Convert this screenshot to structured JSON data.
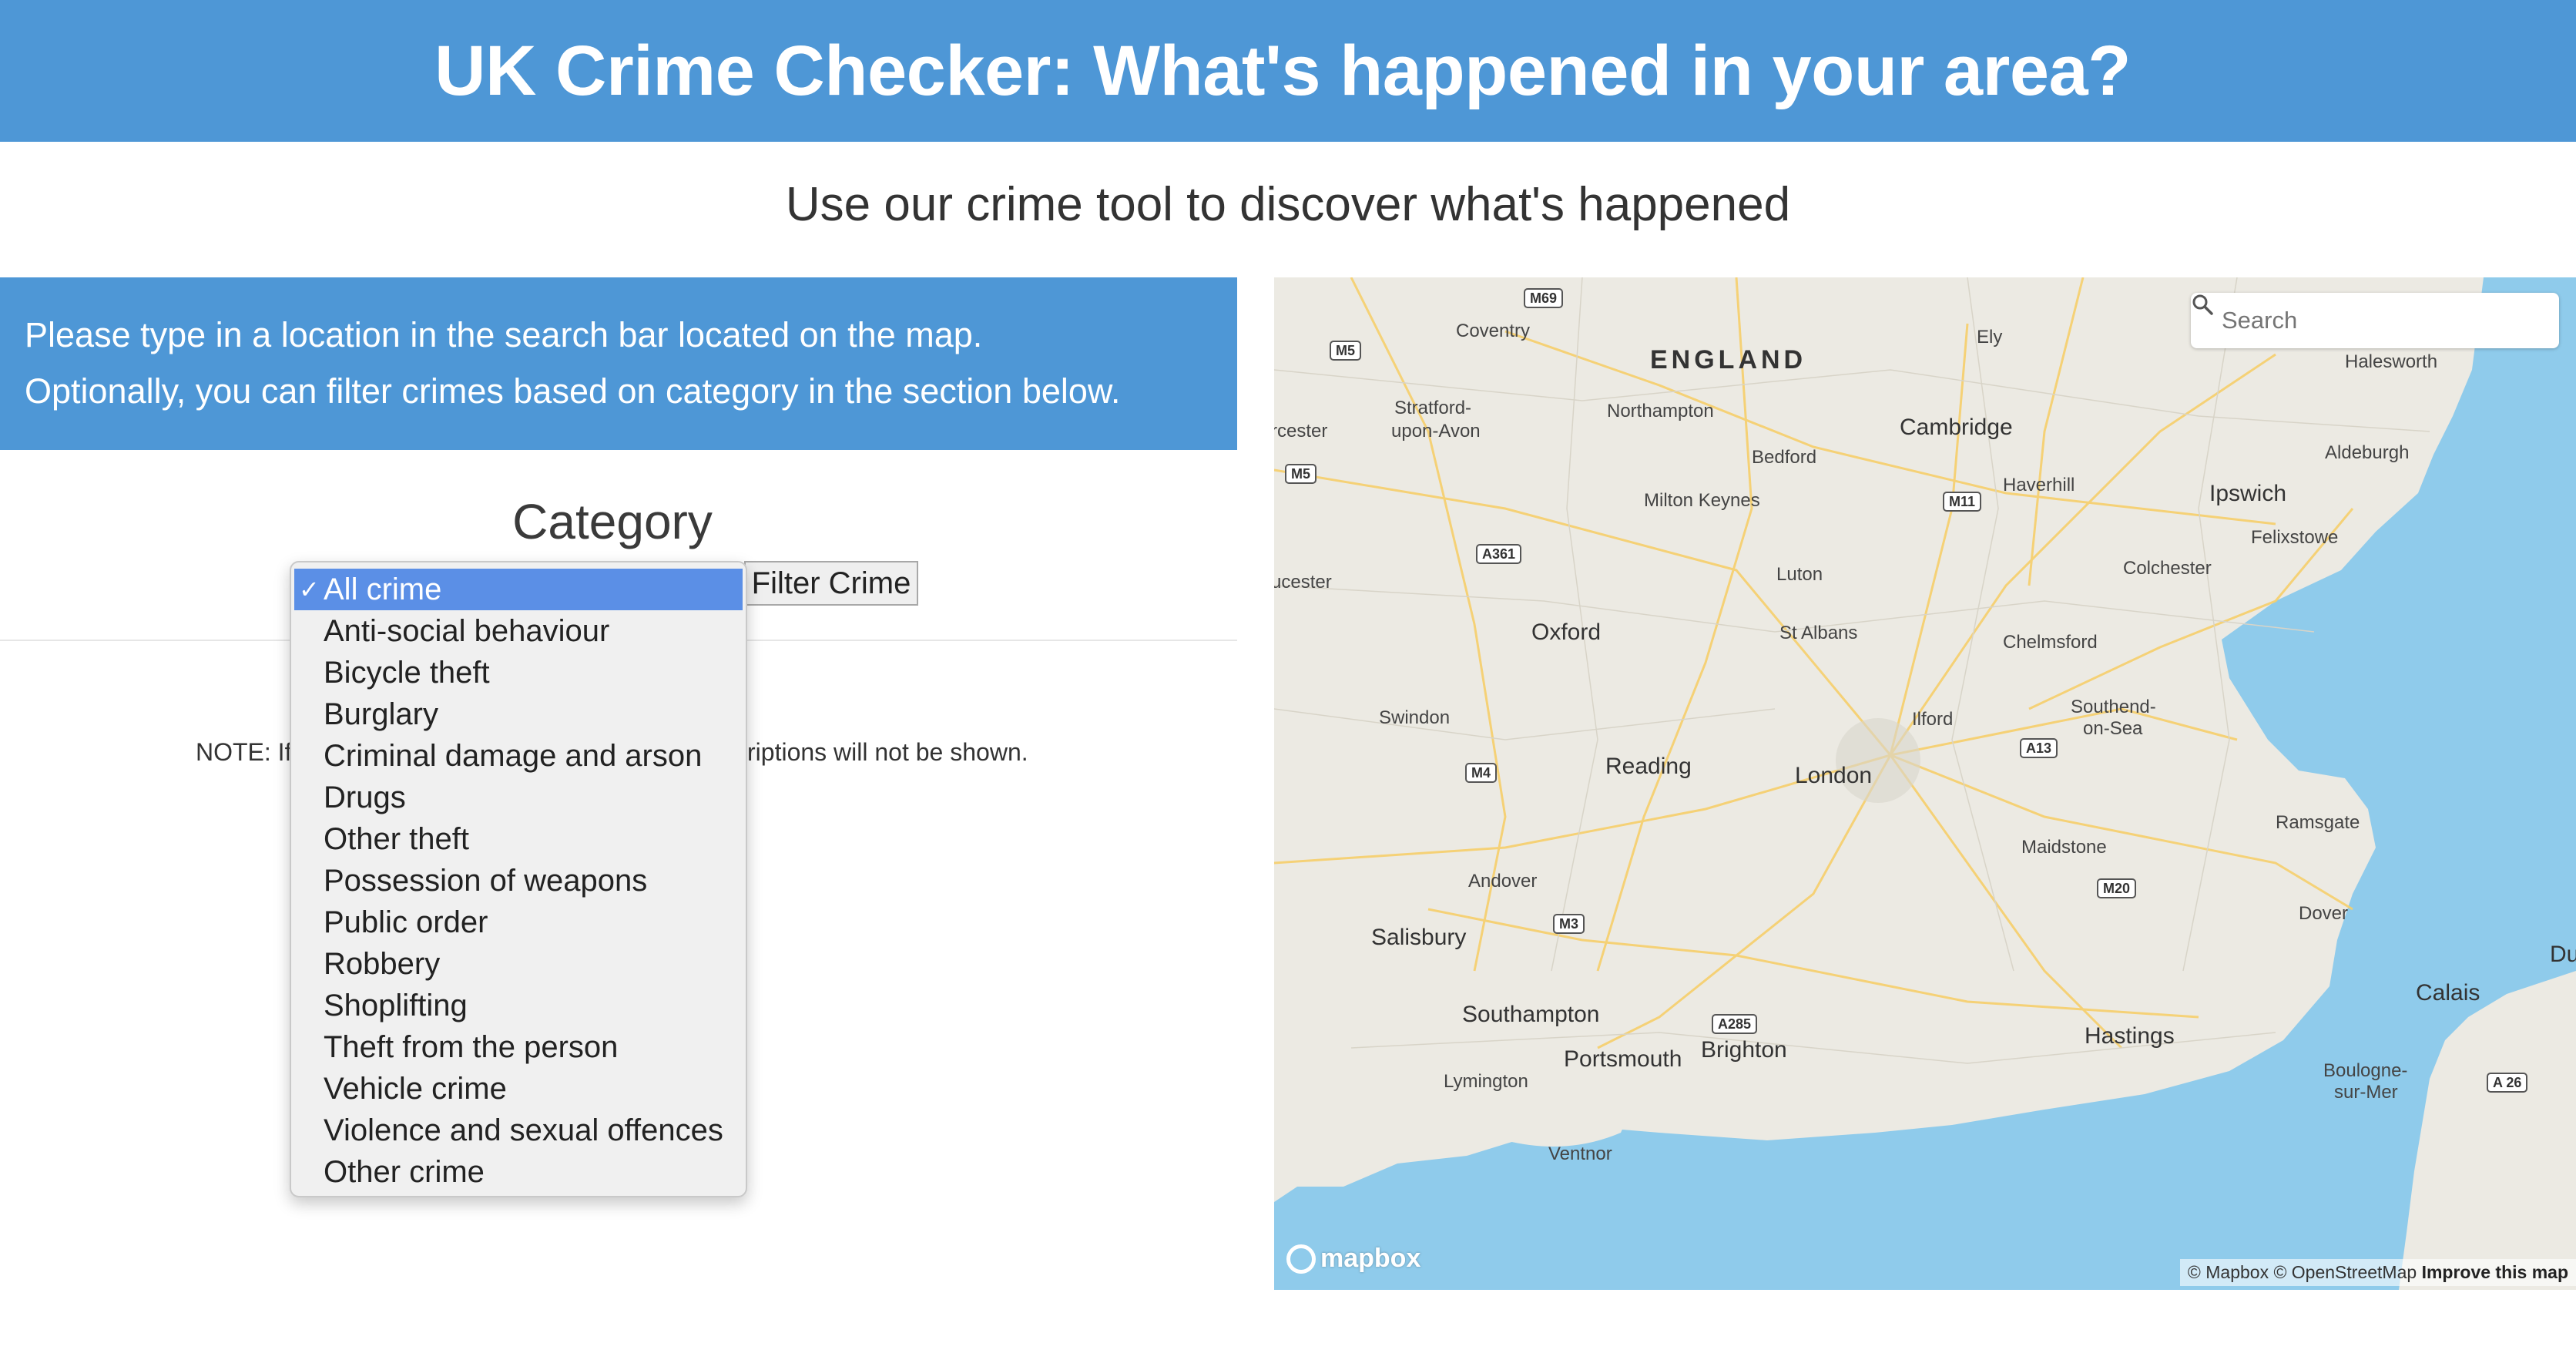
{
  "header": {
    "title": "UK Crime Checker: What's happened in your area?"
  },
  "subtitle": "Use our crime tool to discover what's happened",
  "info": {
    "line1": "Please type in a location in the search bar located on the map.",
    "line2": "Optionally, you can filter crimes based on category in the section below."
  },
  "category": {
    "label": "Category",
    "selected": "All crime",
    "options": [
      "All crime",
      "Anti-social behaviour",
      "Bicycle theft",
      "Burglary",
      "Criminal damage and arson",
      "Drugs",
      "Other theft",
      "Possession of weapons",
      "Public order",
      "Robbery",
      "Shoplifting",
      "Theft from the person",
      "Vehicle crime",
      "Violence and sexual offences",
      "Other crime"
    ]
  },
  "filter_button": "Filter Crime",
  "note": {
    "visible_left": "NOTE: If",
    "visible_right": "riptions will not be shown."
  },
  "map": {
    "search_placeholder": "Search",
    "logo": "mapbox",
    "attribution": "© Mapbox © OpenStreetMap",
    "improve_link": "Improve this map",
    "colors": {
      "land": "#eceae3",
      "water": "#8fcbeb",
      "road": "#f6cf6b"
    },
    "country_label": "ENGLAND",
    "places": [
      {
        "name": "Coventry"
      },
      {
        "name": "Ely"
      },
      {
        "name": "Halesworth"
      },
      {
        "name": "Stratford-"
      },
      {
        "name": "upon-Avon"
      },
      {
        "name": "Northampton"
      },
      {
        "name": "Cambridge"
      },
      {
        "name": "Aldeburgh"
      },
      {
        "name": "Bedford"
      },
      {
        "name": "Haverhill"
      },
      {
        "name": "Ipswich"
      },
      {
        "name": "Milton Keynes"
      },
      {
        "name": "Felixstowe"
      },
      {
        "name": "Colchester"
      },
      {
        "name": "Luton"
      },
      {
        "name": "Oxford"
      },
      {
        "name": "St Albans"
      },
      {
        "name": "Chelmsford"
      },
      {
        "name": "Swindon"
      },
      {
        "name": "Ilford"
      },
      {
        "name": "Southend-"
      },
      {
        "name": "on-Sea"
      },
      {
        "name": "Reading"
      },
      {
        "name": "London"
      },
      {
        "name": "Ramsgate"
      },
      {
        "name": "Maidstone"
      },
      {
        "name": "Andover"
      },
      {
        "name": "Dover"
      },
      {
        "name": "Salisbury"
      },
      {
        "name": "Calais"
      },
      {
        "name": "Southampton"
      },
      {
        "name": "Brighton"
      },
      {
        "name": "Hastings"
      },
      {
        "name": "Portsmouth"
      },
      {
        "name": "Lymington"
      },
      {
        "name": "Boulogne-"
      },
      {
        "name": "sur-Mer"
      },
      {
        "name": "Ventnor"
      },
      {
        "name": "rcester"
      },
      {
        "name": "ucester"
      },
      {
        "name": "Du"
      }
    ],
    "roads": [
      "M69",
      "M5",
      "M5",
      "A361",
      "M11",
      "M4",
      "A13",
      "M20",
      "M3",
      "A285",
      "A 26"
    ]
  }
}
